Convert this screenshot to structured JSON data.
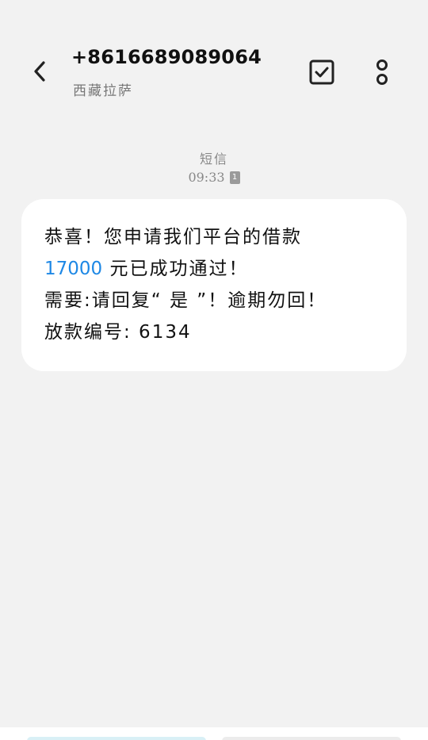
{
  "header": {
    "contact_number": "+8616689089064",
    "contact_location": "西藏拉萨",
    "back_icon": "chevron-left-icon",
    "select_icon": "checkbox-icon",
    "more_icon": "more-vertical-icon"
  },
  "thread": {
    "channel_label": "短信",
    "time": "09:33",
    "sim_slot": "1"
  },
  "message": {
    "line1": "恭喜！您申请我们平台的借款",
    "amount": "17000",
    "line2_rest": " 元已成功通过！",
    "line3": "需要:请回复“ 是 ”！逾期勿回！",
    "line4": "放款编号: 6134"
  },
  "colors": {
    "background": "#f2f2f2",
    "bubble": "#ffffff",
    "link": "#1e88e5",
    "secondary_text": "#888888"
  }
}
